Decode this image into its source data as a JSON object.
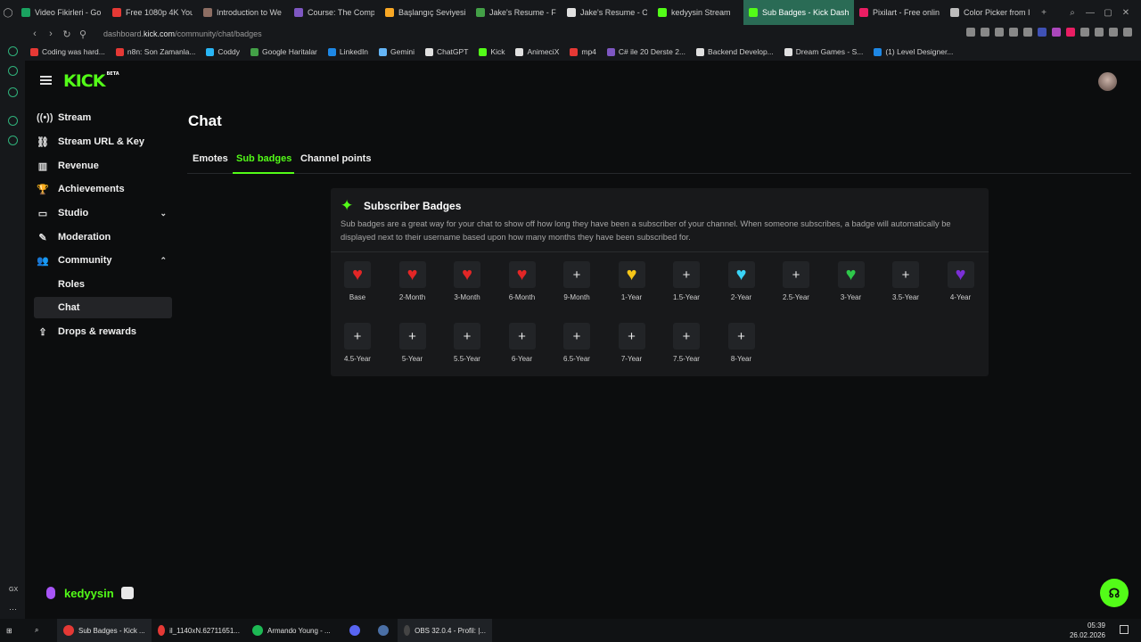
{
  "browser": {
    "tabs": [
      {
        "label": "Video Fikirleri - Go",
        "color": "#1aa260"
      },
      {
        "label": "Free 1080p 4K You",
        "color": "#e53935"
      },
      {
        "label": "Introduction to We",
        "color": "#8d6e63"
      },
      {
        "label": "Course: The Comp",
        "color": "#7e57c2"
      },
      {
        "label": "Başlangıç Seviyesi",
        "color": "#f9a825"
      },
      {
        "label": "Jake's Resume - F",
        "color": "#43a047"
      },
      {
        "label": "Jake's Resume - O",
        "color": "#e0e0e0"
      },
      {
        "label": "kedyysin Stream",
        "color": "#53fc18"
      },
      {
        "label": "Sub Badges - Kick Dashb",
        "color": "#53fc18",
        "active": true
      },
      {
        "label": "Pixilart - Free onlin",
        "color": "#e91e63"
      },
      {
        "label": "Color Picker from I",
        "color": "#bdbdbd"
      }
    ],
    "url_prefix": "dashboard.",
    "url_domain": "kick.com",
    "url_path": "/community/chat/badges",
    "bookmarks": [
      {
        "label": "Coding was hard...",
        "color": "#e53935"
      },
      {
        "label": "n8n: Son Zamanla...",
        "color": "#e53935"
      },
      {
        "label": "Coddy",
        "color": "#29b6f6"
      },
      {
        "label": "Google Haritalar",
        "color": "#43a047"
      },
      {
        "label": "LinkedIn",
        "color": "#1e88e5"
      },
      {
        "label": "Gemini",
        "color": "#64b5f6"
      },
      {
        "label": "ChatGPT",
        "color": "#e0e0e0"
      },
      {
        "label": "Kick",
        "color": "#53fc18"
      },
      {
        "label": "AnimeciX",
        "color": "#e0e0e0"
      },
      {
        "label": "mp4",
        "color": "#e53935"
      },
      {
        "label": "C# ile 20 Derste 2...",
        "color": "#7e57c2"
      },
      {
        "label": "Backend Develop...",
        "color": "#e0e0e0"
      },
      {
        "label": "Dream Games - S...",
        "color": "#e0e0e0"
      },
      {
        "label": "(1) Level Designer...",
        "color": "#1e88e5"
      }
    ]
  },
  "kick": {
    "logo": "KICK",
    "logo_beta": "BETA",
    "sidebar": [
      {
        "label": "Stream",
        "icon": "((•))"
      },
      {
        "label": "Stream URL & Key",
        "icon": "⛓"
      },
      {
        "label": "Revenue",
        "icon": "▥"
      },
      {
        "label": "Achievements",
        "icon": "🏆"
      },
      {
        "label": "Studio",
        "icon": "▭",
        "chevron": "⌄"
      },
      {
        "label": "Moderation",
        "icon": "✎"
      },
      {
        "label": "Community",
        "icon": "👥",
        "chevron": "⌃"
      },
      {
        "label": "Roles",
        "sub": true
      },
      {
        "label": "Chat",
        "sub": true,
        "active": true
      },
      {
        "label": "Drops & rewards",
        "icon": "⇪"
      }
    ],
    "page_title": "Chat",
    "tabs": [
      "Emotes",
      "Sub badges",
      "Channel points"
    ],
    "card_title": "Subscriber Badges",
    "card_desc": "Sub badges are a great way for your chat to show off how long they have been a subscriber of your channel. When someone subscribes, a badge will automatically be displayed next to their username based upon how many months they have been subscribed for.",
    "badges": [
      {
        "label": "Base",
        "heart": "#e32626"
      },
      {
        "label": "2-Month",
        "heart": "#e32626"
      },
      {
        "label": "3-Month",
        "heart": "#e32626"
      },
      {
        "label": "6-Month",
        "heart": "#e32626"
      },
      {
        "label": "9-Month",
        "heart": ""
      },
      {
        "label": "1-Year",
        "heart": "#f5c518"
      },
      {
        "label": "1.5-Year",
        "heart": ""
      },
      {
        "label": "2-Year",
        "heart": "#3ad4f7"
      },
      {
        "label": "2.5-Year",
        "heart": ""
      },
      {
        "label": "3-Year",
        "heart": "#2ec84a"
      },
      {
        "label": "3.5-Year",
        "heart": ""
      },
      {
        "label": "4-Year",
        "heart": "#7b2fd6"
      },
      {
        "label": "4.5-Year",
        "heart": ""
      },
      {
        "label": "5-Year",
        "heart": ""
      },
      {
        "label": "5.5-Year",
        "heart": ""
      },
      {
        "label": "6-Year",
        "heart": ""
      },
      {
        "label": "6.5-Year",
        "heart": ""
      },
      {
        "label": "7-Year",
        "heart": ""
      },
      {
        "label": "7.5-Year",
        "heart": ""
      },
      {
        "label": "8-Year",
        "heart": ""
      }
    ],
    "username": "kedyysin",
    "accent": "#53fc18"
  },
  "taskbar": {
    "items": [
      {
        "label": "Sub Badges - Kick ...",
        "color": "#e53935"
      },
      {
        "label": "il_1140xN.62711651...",
        "color": "#e53935"
      },
      {
        "label": "Armando Young - ...",
        "color": "#1db954"
      },
      {
        "label": "",
        "color": "#5865f2"
      },
      {
        "label": "",
        "color": "#4a6fa5"
      },
      {
        "label": "OBS 32.0.4 - Profil: |...",
        "color": "#444"
      }
    ],
    "time": "05:39",
    "date": "26.02.2026"
  }
}
